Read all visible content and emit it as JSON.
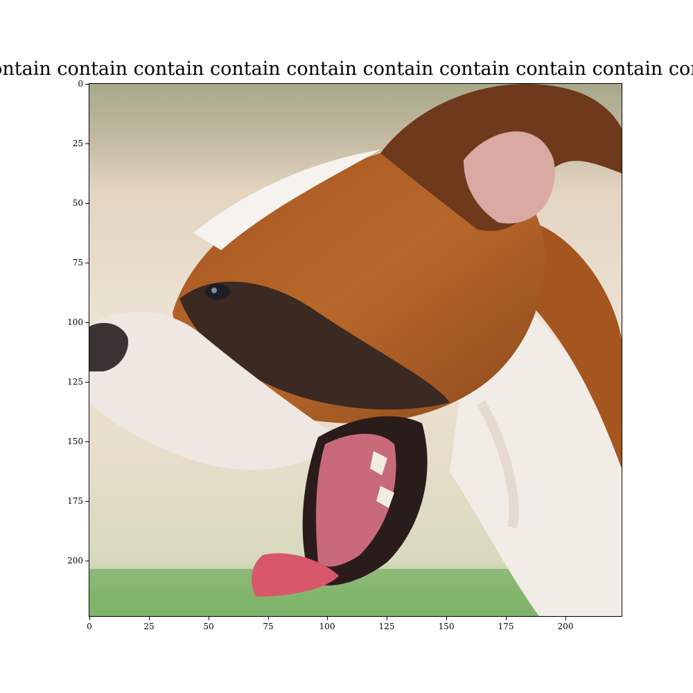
{
  "figure": {
    "title": "contain contain contain contain contain contain contain contain contain contain",
    "image_subject": "Side profile of a brown and white boxer dog yawning with mouth wide open",
    "y_ticks": [
      "0",
      "25",
      "50",
      "75",
      "100",
      "125",
      "150",
      "175",
      "200"
    ],
    "x_ticks": [
      "0",
      "25",
      "50",
      "75",
      "100",
      "125",
      "150",
      "175",
      "200"
    ],
    "image_size": [
      224,
      224
    ]
  }
}
